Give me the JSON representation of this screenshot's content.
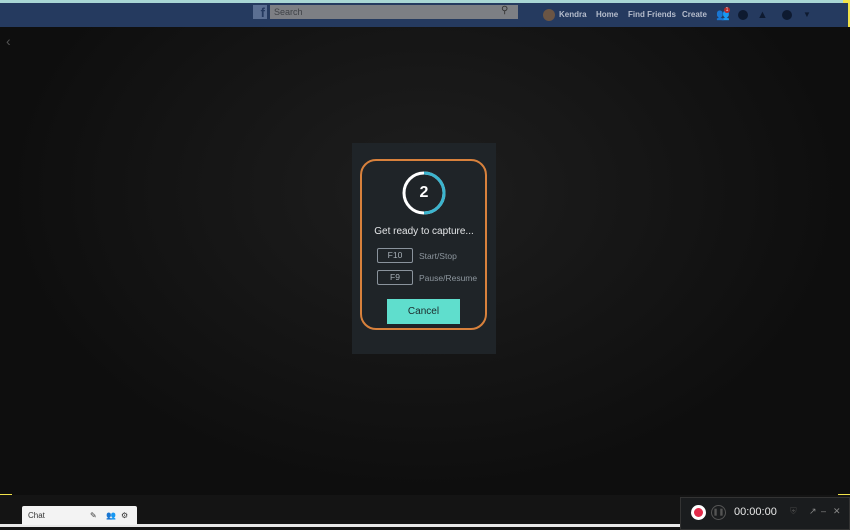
{
  "facebook": {
    "search_placeholder": "Search",
    "user": "Kendra",
    "nav": [
      "Home",
      "Find Friends",
      "Create"
    ],
    "notification_count": "1"
  },
  "dialog": {
    "countdown": "2",
    "countdown_progress": 0.5,
    "message": "Get ready to capture...",
    "shortcuts": [
      {
        "key": "F10",
        "action": "Start/Stop"
      },
      {
        "key": "F9",
        "action": "Pause/Resume"
      }
    ],
    "cancel_label": "Cancel",
    "accent": "#5fdecd",
    "border_color": "#d8813c"
  },
  "chat": {
    "label": "Chat"
  },
  "recorder": {
    "timer": "00:00:00",
    "record_color": "#e22b4a"
  }
}
